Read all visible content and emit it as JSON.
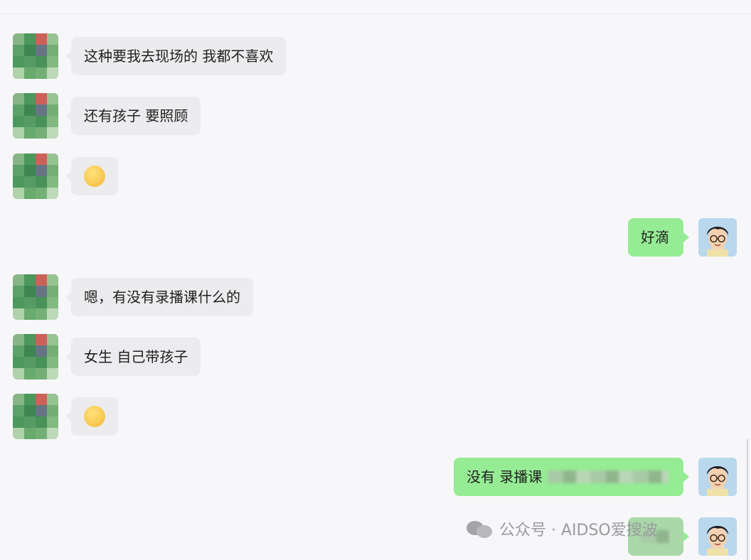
{
  "chat": {
    "messages": [
      {
        "side": "in",
        "text": "这种要我去现场的 我都不喜欢"
      },
      {
        "side": "in",
        "text": "还有孩子  要照顾"
      },
      {
        "side": "in",
        "emoji": "pleading-face-emoji"
      },
      {
        "side": "out",
        "text": "好滴"
      },
      {
        "side": "in",
        "text": "嗯，有没有录播课什么的"
      },
      {
        "side": "in",
        "text": "女生 自己带孩子"
      },
      {
        "side": "in",
        "emoji": "smiling-face-emoji"
      },
      {
        "side": "out",
        "text": "没有  录播课"
      }
    ]
  },
  "watermark": {
    "text": "公众号 · AIDSO爱搜波"
  },
  "colors": {
    "incoming_bubble": "#ececef",
    "outgoing_bubble": "#95ec94",
    "background": "#f7f7f9"
  }
}
